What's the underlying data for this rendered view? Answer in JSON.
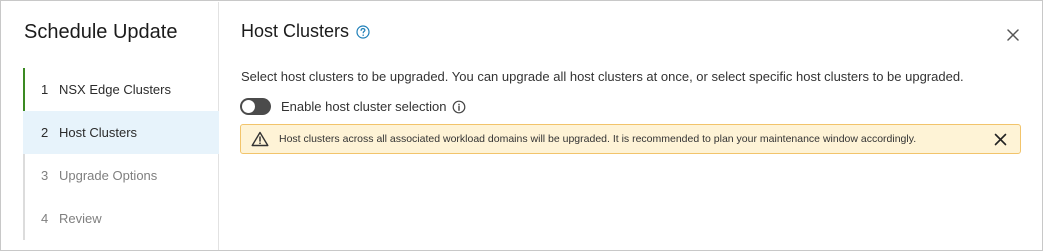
{
  "wizard": {
    "title": "Schedule Update",
    "steps": [
      {
        "number": "1",
        "label": "NSX Edge Clusters",
        "state": "completed"
      },
      {
        "number": "2",
        "label": "Host Clusters",
        "state": "active"
      },
      {
        "number": "3",
        "label": "Upgrade Options",
        "state": "future"
      },
      {
        "number": "4",
        "label": "Review",
        "state": "future"
      }
    ]
  },
  "main": {
    "title": "Host Clusters",
    "help_icon": "help-circle-icon",
    "close_icon": "close-icon",
    "description": "Select host clusters to be upgraded. You can upgrade all host clusters at once, or select specific host clusters to be upgraded.",
    "toggle": {
      "label": "Enable host cluster selection",
      "enabled": false,
      "info_icon": "info-circle-icon"
    },
    "alert": {
      "type": "warning",
      "icon": "warning-triangle-icon",
      "text": "Host clusters across all associated workload domains will be upgraded. It is recommended to plan your maintenance window accordingly.",
      "close_icon": "close-icon"
    }
  },
  "colors": {
    "completed_step": "#3b8a22",
    "active_step_bg": "#e7f3fb",
    "help_icon": "#1e7fb8",
    "alert_bg": "#fef3d6",
    "alert_border": "#f2c46b",
    "toggle_off": "#4b4b4b"
  }
}
